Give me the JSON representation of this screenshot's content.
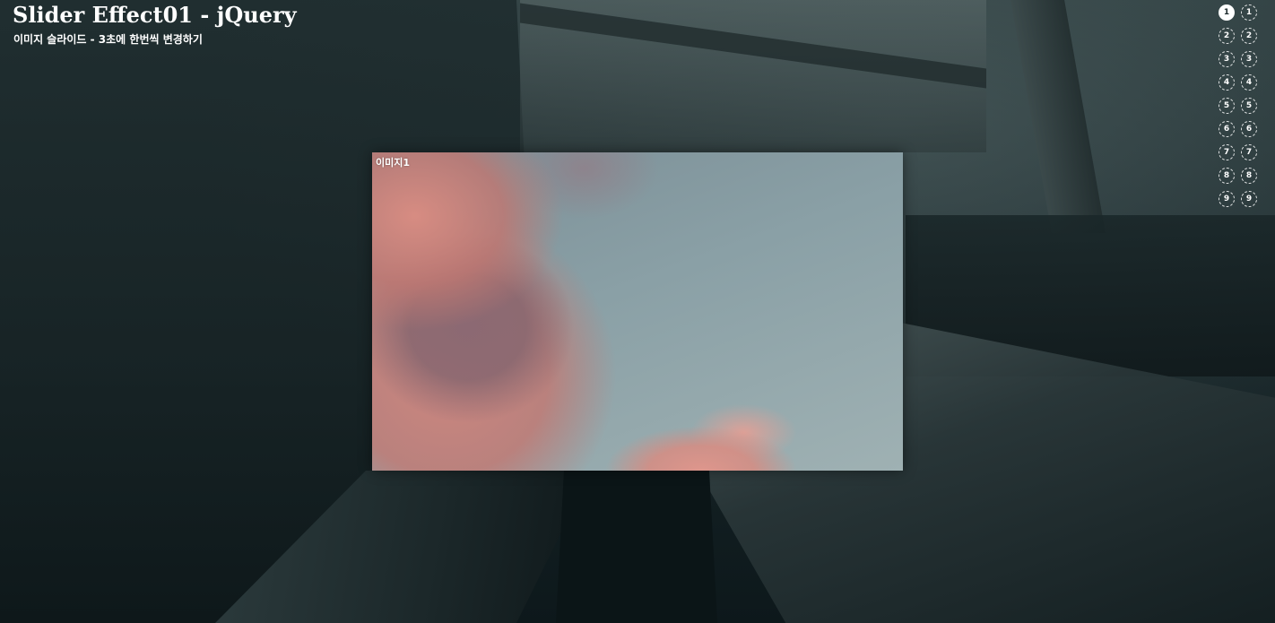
{
  "header": {
    "title": "Slider Effect01 - jQuery",
    "subtitle": "이미지 슬라이드 - 3초에 한번씩 변경하기"
  },
  "slider": {
    "current_caption": "이미지1",
    "active_index": 1
  },
  "pagination": {
    "column_a": [
      "1",
      "2",
      "3",
      "4",
      "5",
      "6",
      "7",
      "8",
      "9"
    ],
    "column_b": [
      "1",
      "2",
      "3",
      "4",
      "5",
      "6",
      "7",
      "8",
      "9"
    ]
  },
  "colors": {
    "text": "#ffffff",
    "background": "#142124"
  }
}
